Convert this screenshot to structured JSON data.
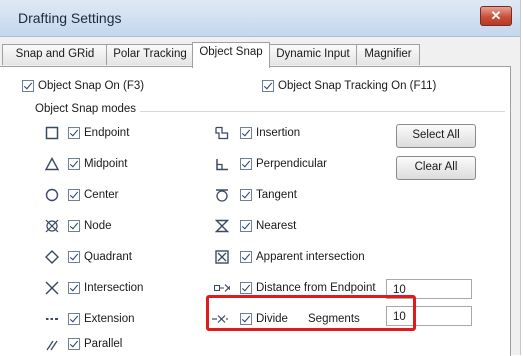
{
  "window": {
    "title": "Drafting Settings",
    "close_glyph": "✕"
  },
  "tabs": [
    {
      "label": "Snap and GRid"
    },
    {
      "label": "Polar Tracking"
    },
    {
      "label": "Object Snap",
      "active": true
    },
    {
      "label": "Dynamic Input"
    },
    {
      "label": "Magnifier"
    }
  ],
  "options": {
    "snap_on": {
      "label": "Object Snap On (F3)",
      "checked": true
    },
    "tracking_on": {
      "label": "Object Snap Tracking On (F11)",
      "checked": true
    }
  },
  "modes_group": {
    "label": "Object Snap modes"
  },
  "left_modes": [
    {
      "icon": "endpoint-icon",
      "label": "Endpoint",
      "checked": true
    },
    {
      "icon": "midpoint-icon",
      "label": "Midpoint",
      "checked": true
    },
    {
      "icon": "center-icon",
      "label": "Center",
      "checked": true
    },
    {
      "icon": "node-icon",
      "label": "Node",
      "checked": true
    },
    {
      "icon": "quadrant-icon",
      "label": "Quadrant",
      "checked": true
    },
    {
      "icon": "intersection-icon",
      "label": "Intersection",
      "checked": true
    },
    {
      "icon": "extension-icon",
      "label": "Extension",
      "checked": true
    },
    {
      "icon": "parallel-icon",
      "label": "Parallel",
      "checked": true
    }
  ],
  "right_modes": [
    {
      "icon": "insertion-icon",
      "label": "Insertion",
      "checked": true
    },
    {
      "icon": "perpendicular-icon",
      "label": "Perpendicular",
      "checked": true
    },
    {
      "icon": "tangent-icon",
      "label": "Tangent",
      "checked": true
    },
    {
      "icon": "nearest-icon",
      "label": "Nearest",
      "checked": true
    },
    {
      "icon": "apparent-intersection-icon",
      "label": "Apparent intersection",
      "checked": true
    },
    {
      "icon": "distance-from-endpoint-icon",
      "label": "Distance from Endpoint",
      "checked": true,
      "value": "10"
    },
    {
      "icon": "divide-icon",
      "label": "Divide",
      "checked": true,
      "sub_label": "Segments",
      "value": "10"
    }
  ],
  "buttons": {
    "select_all": "Select All",
    "clear_all": "Clear All"
  },
  "colors": {
    "highlight": "#e01b1b",
    "title_bar": "#c4d7ec"
  }
}
